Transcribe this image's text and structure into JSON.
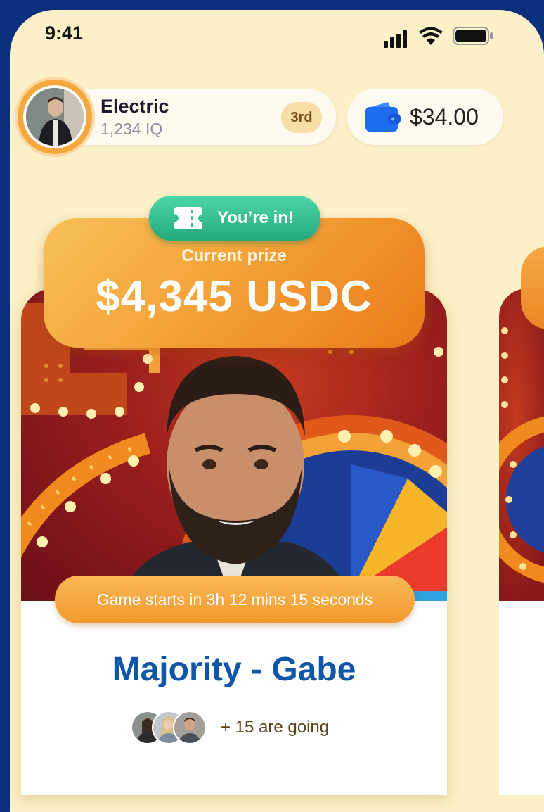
{
  "status_bar": {
    "time": "9:41"
  },
  "profile": {
    "name": "Electric",
    "iq": "1,234 IQ",
    "rank": "3rd"
  },
  "wallet": {
    "balance": "$34.00"
  },
  "game_card": {
    "badge": "You’re in!",
    "prize_label": "Current prize",
    "prize_amount": "$4,345 USDC",
    "countdown": "Game starts in 3h 12 mins 15 seconds",
    "title": "Majority - Gabe",
    "attendees_text": "+ 15 are going"
  },
  "colors": {
    "background": "#fcf0c8",
    "frame": "#0b2f7a",
    "accent_orange": "#f3a33a",
    "accent_green": "#23a97c",
    "title_blue": "#0f56a6",
    "wallet_blue": "#1e6cf0"
  },
  "icons": [
    "signal-icon",
    "wifi-icon",
    "battery-icon",
    "wallet-icon",
    "ticket-icon"
  ]
}
